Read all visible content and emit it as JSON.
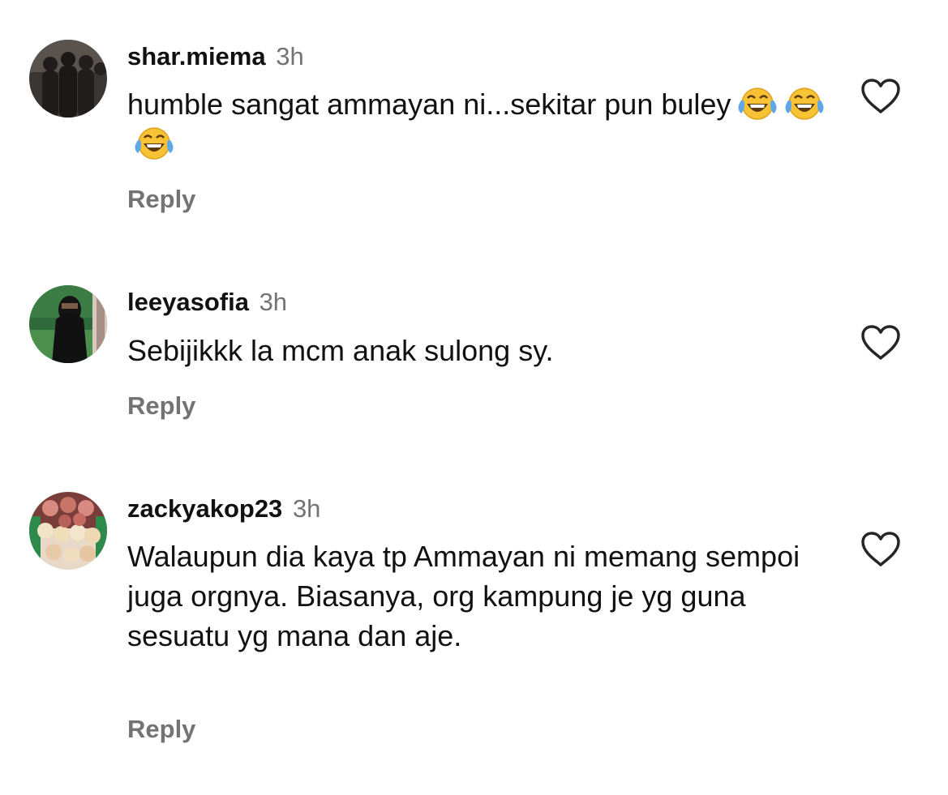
{
  "comments": [
    {
      "username": "shar.miema",
      "time": "3h",
      "text": "humble sangat ammayan ni...sekitar pun buley",
      "emoji": "face-with-tears-of-joy",
      "emoji_count": 3,
      "reply_label": "Reply"
    },
    {
      "username": "leeyasofia",
      "time": "3h",
      "text": "Sebijikkk la mcm anak sulong sy.",
      "reply_label": "Reply"
    },
    {
      "username": "zackyakop23",
      "time": "3h",
      "text": "Walaupun dia kaya tp Ammayan ni memang sempoi juga orgnya. Biasanya, org kampung je yg guna sesuatu yg mana dan aje.",
      "reply_label": "Reply"
    }
  ],
  "colors": {
    "text": "#111111",
    "secondary": "#737373",
    "background": "#ffffff"
  },
  "icons": {
    "like": "heart-outline-icon",
    "emoji": "face-with-tears-of-joy-icon"
  }
}
